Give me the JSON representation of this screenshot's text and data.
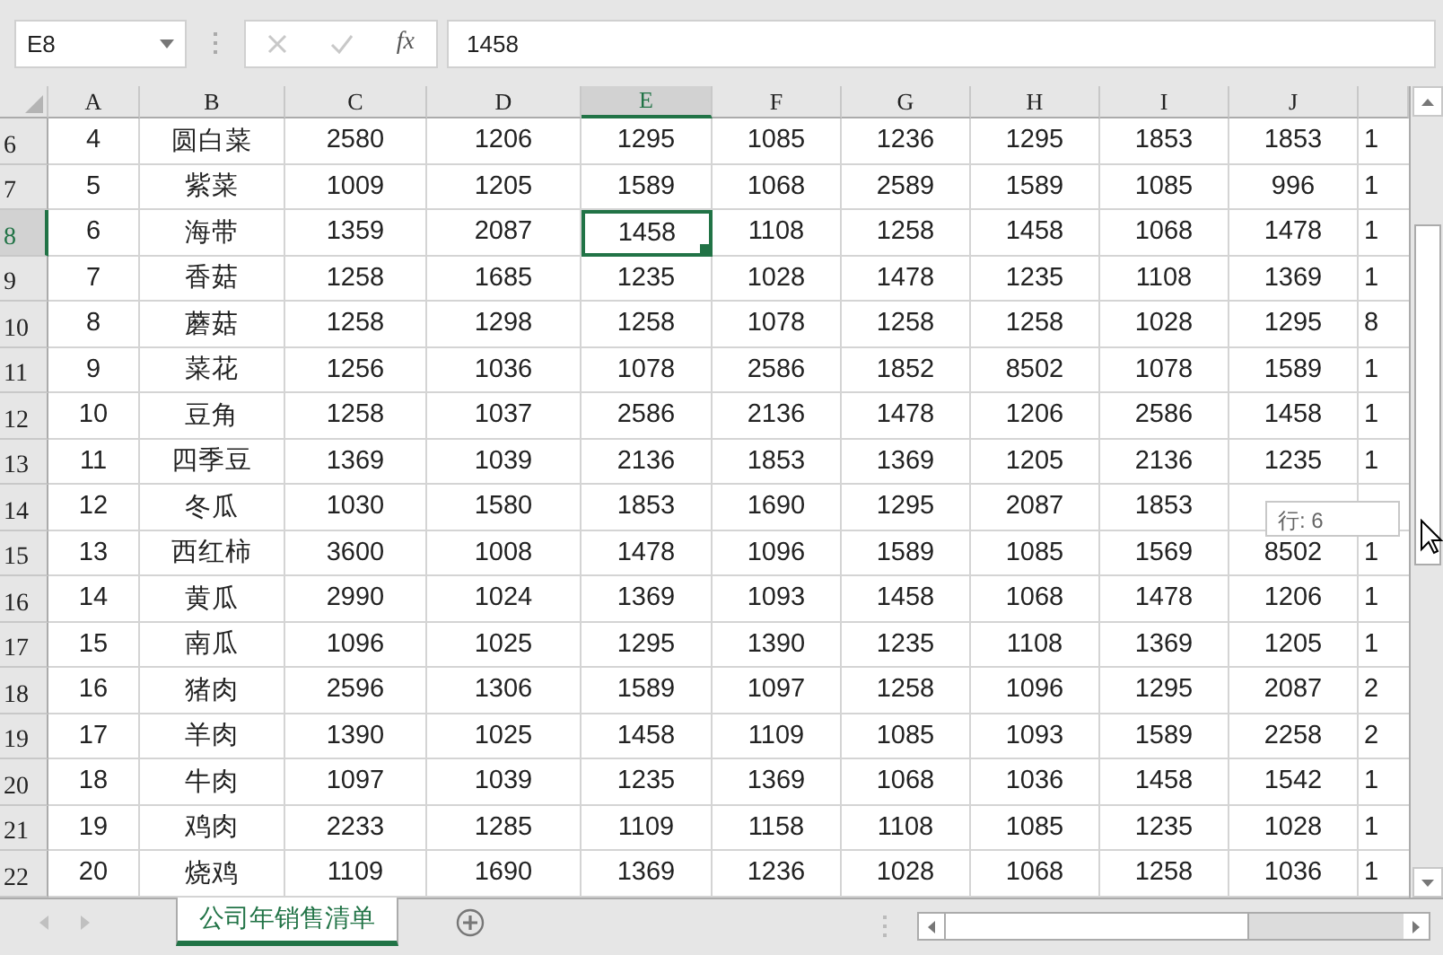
{
  "name_box": {
    "value": "E8"
  },
  "formula_bar": {
    "fx": "fx",
    "value": "1458",
    "cancel_disabled": true,
    "confirm_disabled": true
  },
  "columns": [
    {
      "label": "A",
      "selected": false
    },
    {
      "label": "B",
      "selected": false
    },
    {
      "label": "C",
      "selected": false
    },
    {
      "label": "D",
      "selected": false
    },
    {
      "label": "E",
      "selected": true
    },
    {
      "label": "F",
      "selected": false
    },
    {
      "label": "G",
      "selected": false
    },
    {
      "label": "H",
      "selected": false
    },
    {
      "label": "I",
      "selected": false
    },
    {
      "label": "J",
      "selected": false
    }
  ],
  "rows": [
    {
      "label": "6",
      "selected": false,
      "cells": [
        "4",
        "圆白菜",
        "2580",
        "1206",
        "1295",
        "1085",
        "1236",
        "1295",
        "1853",
        "1853",
        "1"
      ]
    },
    {
      "label": "7",
      "selected": false,
      "cells": [
        "5",
        "紫菜",
        "1009",
        "1205",
        "1589",
        "1068",
        "2589",
        "1589",
        "1085",
        "996",
        "1"
      ]
    },
    {
      "label": "8",
      "selected": true,
      "cells": [
        "6",
        "海带",
        "1359",
        "2087",
        "1458",
        "1108",
        "1258",
        "1458",
        "1068",
        "1478",
        "1"
      ]
    },
    {
      "label": "9",
      "selected": false,
      "cells": [
        "7",
        "香菇",
        "1258",
        "1685",
        "1235",
        "1028",
        "1478",
        "1235",
        "1108",
        "1369",
        "1"
      ]
    },
    {
      "label": "10",
      "selected": false,
      "cells": [
        "8",
        "蘑菇",
        "1258",
        "1298",
        "1258",
        "1078",
        "1258",
        "1258",
        "1028",
        "1295",
        "8"
      ]
    },
    {
      "label": "11",
      "selected": false,
      "cells": [
        "9",
        "菜花",
        "1256",
        "1036",
        "1078",
        "2586",
        "1852",
        "8502",
        "1078",
        "1589",
        "1"
      ]
    },
    {
      "label": "12",
      "selected": false,
      "cells": [
        "10",
        "豆角",
        "1258",
        "1037",
        "2586",
        "2136",
        "1478",
        "1206",
        "2586",
        "1458",
        "1"
      ]
    },
    {
      "label": "13",
      "selected": false,
      "cells": [
        "11",
        "四季豆",
        "1369",
        "1039",
        "2136",
        "1853",
        "1369",
        "1205",
        "2136",
        "1235",
        "1"
      ]
    },
    {
      "label": "14",
      "selected": false,
      "cells": [
        "12",
        "冬瓜",
        "1030",
        "1580",
        "1853",
        "1690",
        "1295",
        "2087",
        "1853",
        null,
        null
      ]
    },
    {
      "label": "15",
      "selected": false,
      "cells": [
        "13",
        "西红柿",
        "3600",
        "1008",
        "1478",
        "1096",
        "1589",
        "1085",
        "1569",
        "8502",
        "1"
      ]
    },
    {
      "label": "16",
      "selected": false,
      "cells": [
        "14",
        "黄瓜",
        "2990",
        "1024",
        "1369",
        "1093",
        "1458",
        "1068",
        "1478",
        "1206",
        "1"
      ]
    },
    {
      "label": "17",
      "selected": false,
      "cells": [
        "15",
        "南瓜",
        "1096",
        "1025",
        "1295",
        "1390",
        "1235",
        "1108",
        "1369",
        "1205",
        "1"
      ]
    },
    {
      "label": "18",
      "selected": false,
      "cells": [
        "16",
        "猪肉",
        "2596",
        "1306",
        "1589",
        "1097",
        "1258",
        "1096",
        "1295",
        "2087",
        "2"
      ]
    },
    {
      "label": "19",
      "selected": false,
      "cells": [
        "17",
        "羊肉",
        "1390",
        "1025",
        "1458",
        "1109",
        "1085",
        "1093",
        "1589",
        "2258",
        "2"
      ]
    },
    {
      "label": "20",
      "selected": false,
      "cells": [
        "18",
        "牛肉",
        "1097",
        "1039",
        "1235",
        "1369",
        "1068",
        "1036",
        "1458",
        "1542",
        "1"
      ]
    },
    {
      "label": "21",
      "selected": false,
      "cells": [
        "19",
        "鸡肉",
        "2233",
        "1285",
        "1109",
        "1158",
        "1108",
        "1085",
        "1235",
        "1028",
        "1"
      ]
    },
    {
      "label": "22",
      "selected": false,
      "cells": [
        "20",
        "烧鸡",
        "1109",
        "1690",
        "1369",
        "1236",
        "1028",
        "1068",
        "1258",
        "1036",
        "1"
      ]
    }
  ],
  "tooltip": {
    "text": "行: 6"
  },
  "sheet_tabs": [
    {
      "label": "公司年销售清单",
      "selected": true
    }
  ]
}
